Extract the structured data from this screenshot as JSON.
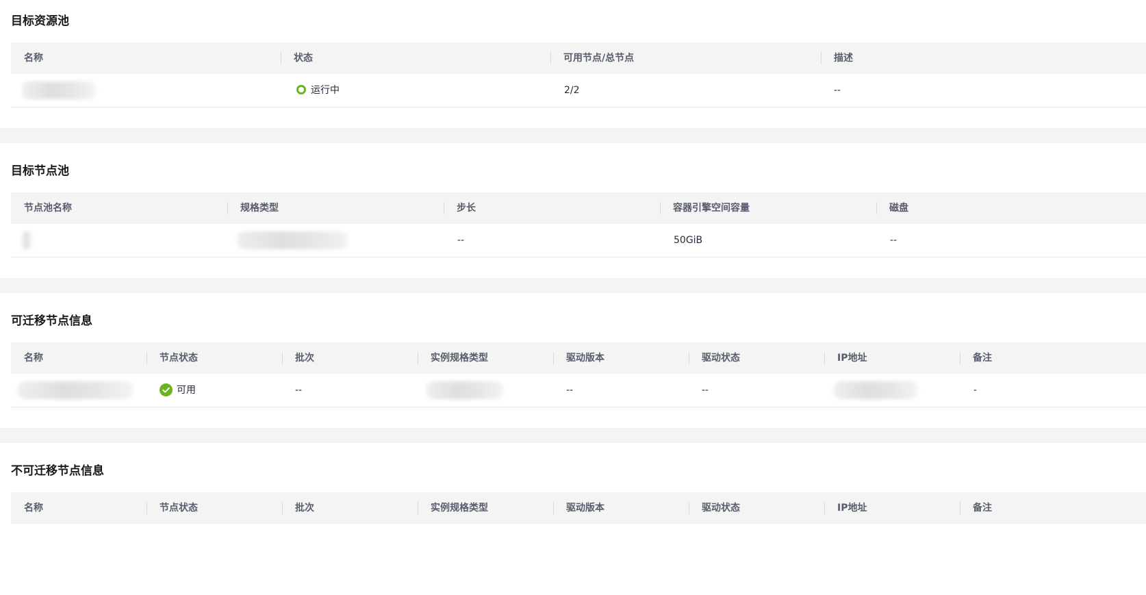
{
  "colors": {
    "accent_green": "#6ab321",
    "header_bg": "#f4f4f4",
    "separator_bg": "#f4f4f4"
  },
  "icons": {
    "running": "ring-status-icon",
    "available": "check-circle-icon"
  },
  "target_resource_pool": {
    "title": "目标资源池",
    "columns": [
      "名称",
      "状态",
      "可用节点/总节点",
      "描述"
    ],
    "rows": [
      {
        "name": "",
        "status": "运行中",
        "nodes": "2/2",
        "description": "--"
      }
    ]
  },
  "target_node_pool": {
    "title": "目标节点池",
    "columns": [
      "节点池名称",
      "规格类型",
      "步长",
      "容器引擎空间容量",
      "磁盘"
    ],
    "rows": [
      {
        "name": "",
        "spec": "",
        "step": "--",
        "capacity": "50GiB",
        "disk": "--"
      }
    ]
  },
  "migratable_nodes": {
    "title": "可迁移节点信息",
    "columns": [
      "名称",
      "节点状态",
      "批次",
      "实例规格类型",
      "驱动版本",
      "驱动状态",
      "IP地址",
      "备注"
    ],
    "rows": [
      {
        "name": "",
        "status": "可用",
        "batch": "--",
        "instance_type": "",
        "driver_version": "--",
        "driver_status": "--",
        "ip": "",
        "remark": "-"
      }
    ]
  },
  "non_migratable_nodes": {
    "title": "不可迁移节点信息",
    "columns": [
      "名称",
      "节点状态",
      "批次",
      "实例规格类型",
      "驱动版本",
      "驱动状态",
      "IP地址",
      "备注"
    ]
  }
}
